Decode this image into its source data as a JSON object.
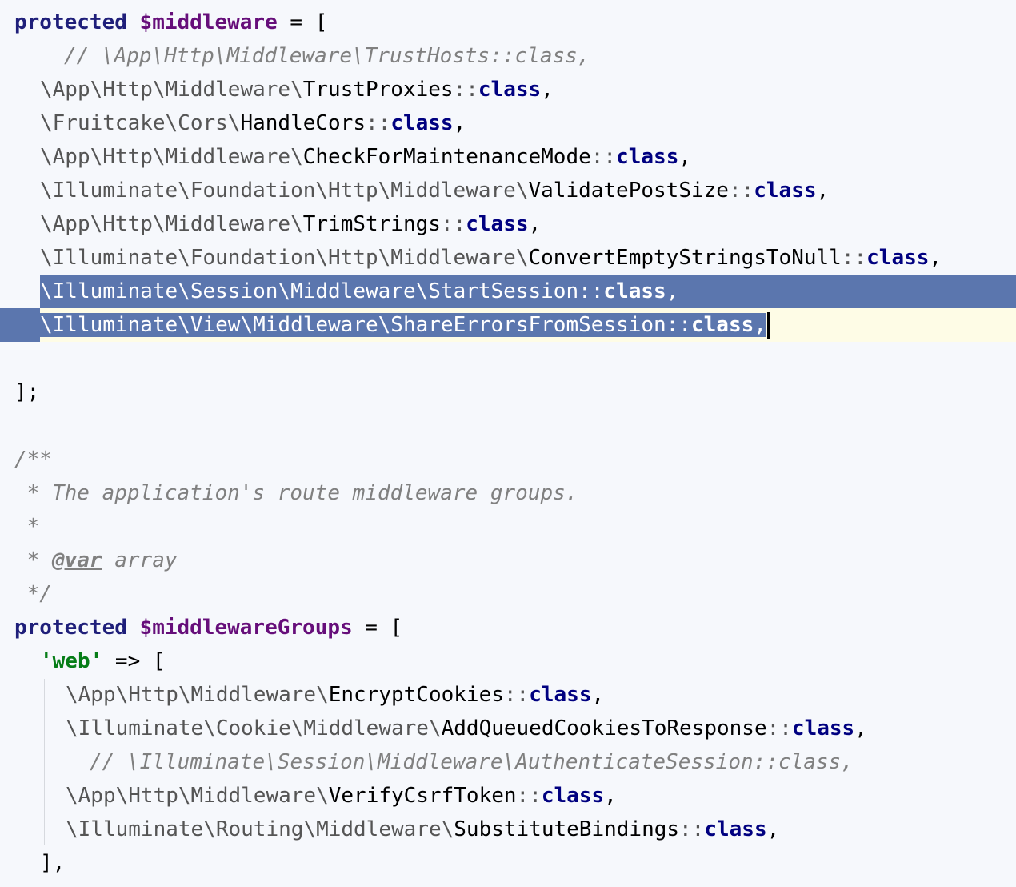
{
  "lines": [
    {
      "tokens": [
        {
          "t": "protected",
          "c": "kw2"
        },
        {
          "t": " ",
          "c": ""
        },
        {
          "t": "$middleware",
          "c": "var"
        },
        {
          "t": " = [",
          "c": ""
        }
      ]
    },
    {
      "tokens": [
        {
          "t": "// \\App\\Http\\Middleware\\TrustHosts::class,",
          "c": "cmt"
        }
      ]
    },
    {
      "tokens": [
        {
          "t": "\\App\\Http\\Middleware\\",
          "c": "ns"
        },
        {
          "t": "TrustProxies",
          "c": ""
        },
        {
          "t": "::",
          "c": "ns"
        },
        {
          "t": "class",
          "c": "cls"
        },
        {
          "t": ",",
          "c": ""
        }
      ]
    },
    {
      "tokens": [
        {
          "t": "\\Fruitcake\\Cors\\",
          "c": "ns"
        },
        {
          "t": "HandleCors",
          "c": ""
        },
        {
          "t": "::",
          "c": "ns"
        },
        {
          "t": "class",
          "c": "cls"
        },
        {
          "t": ",",
          "c": ""
        }
      ]
    },
    {
      "tokens": [
        {
          "t": "\\App\\Http\\Middleware\\",
          "c": "ns"
        },
        {
          "t": "CheckForMaintenanceMode",
          "c": ""
        },
        {
          "t": "::",
          "c": "ns"
        },
        {
          "t": "class",
          "c": "cls"
        },
        {
          "t": ",",
          "c": ""
        }
      ]
    },
    {
      "tokens": [
        {
          "t": "\\Illuminate\\Foundation\\Http\\Middleware\\",
          "c": "ns"
        },
        {
          "t": "ValidatePostSize",
          "c": ""
        },
        {
          "t": "::",
          "c": "ns"
        },
        {
          "t": "class",
          "c": "cls"
        },
        {
          "t": ",",
          "c": ""
        }
      ]
    },
    {
      "tokens": [
        {
          "t": "\\App\\Http\\Middleware\\",
          "c": "ns"
        },
        {
          "t": "TrimStrings",
          "c": ""
        },
        {
          "t": "::",
          "c": "ns"
        },
        {
          "t": "class",
          "c": "cls"
        },
        {
          "t": ",",
          "c": ""
        }
      ]
    },
    {
      "tokens": [
        {
          "t": "\\Illuminate\\Foundation\\Http\\Middleware\\",
          "c": "ns"
        },
        {
          "t": "ConvertEmptyStringsToNull",
          "c": ""
        },
        {
          "t": "::",
          "c": "ns"
        },
        {
          "t": "class",
          "c": "cls"
        },
        {
          "t": ",",
          "c": ""
        }
      ]
    },
    {
      "tokens": [
        {
          "t": "\\Illuminate\\Session\\Middleware\\",
          "c": "ns"
        },
        {
          "t": "StartSession",
          "c": ""
        },
        {
          "t": "::",
          "c": "ns"
        },
        {
          "t": "class",
          "c": "cls"
        },
        {
          "t": ",",
          "c": ""
        }
      ]
    },
    {
      "tokens": [
        {
          "t": "\\Illuminate\\View\\Middleware\\",
          "c": "ns"
        },
        {
          "t": "ShareErrorsFromSession",
          "c": ""
        },
        {
          "t": "::",
          "c": "ns"
        },
        {
          "t": "class",
          "c": "cls"
        },
        {
          "t": ",",
          "c": ""
        }
      ]
    },
    {
      "tokens": []
    },
    {
      "tokens": [
        {
          "t": "];",
          "c": ""
        }
      ]
    },
    {
      "tokens": []
    },
    {
      "tokens": [
        {
          "t": "/**",
          "c": "cmt"
        }
      ]
    },
    {
      "tokens": [
        {
          "t": " * The application's route middleware groups.",
          "c": "cmt"
        }
      ]
    },
    {
      "tokens": [
        {
          "t": " *",
          "c": "cmt"
        }
      ]
    },
    {
      "tokens": [
        {
          "t": " * ",
          "c": "cmt"
        },
        {
          "t": "@var",
          "c": "doctag"
        },
        {
          "t": " array",
          "c": "cmt"
        }
      ]
    },
    {
      "tokens": [
        {
          "t": " */",
          "c": "cmt"
        }
      ]
    },
    {
      "tokens": [
        {
          "t": "protected",
          "c": "kw2"
        },
        {
          "t": " ",
          "c": ""
        },
        {
          "t": "$middlewareGroups",
          "c": "var"
        },
        {
          "t": " = [",
          "c": ""
        }
      ]
    },
    {
      "tokens": [
        {
          "t": "'web'",
          "c": "str"
        },
        {
          "t": " => [",
          "c": ""
        }
      ]
    },
    {
      "tokens": [
        {
          "t": "\\App\\Http\\Middleware\\",
          "c": "ns"
        },
        {
          "t": "EncryptCookies",
          "c": ""
        },
        {
          "t": "::",
          "c": "ns"
        },
        {
          "t": "class",
          "c": "cls"
        },
        {
          "t": ",",
          "c": ""
        }
      ]
    },
    {
      "tokens": [
        {
          "t": "\\Illuminate\\Cookie\\Middleware\\",
          "c": "ns"
        },
        {
          "t": "AddQueuedCookiesToResponse",
          "c": ""
        },
        {
          "t": "::",
          "c": "ns"
        },
        {
          "t": "class",
          "c": "cls"
        },
        {
          "t": ",",
          "c": ""
        }
      ]
    },
    {
      "tokens": [
        {
          "t": "// \\Illuminate\\Session\\Middleware\\AuthenticateSession::class,",
          "c": "cmt"
        }
      ]
    },
    {
      "tokens": [
        {
          "t": "\\App\\Http\\Middleware\\",
          "c": "ns"
        },
        {
          "t": "VerifyCsrfToken",
          "c": ""
        },
        {
          "t": "::",
          "c": "ns"
        },
        {
          "t": "class",
          "c": "cls"
        },
        {
          "t": ",",
          "c": ""
        }
      ]
    },
    {
      "tokens": [
        {
          "t": "\\Illuminate\\Routing\\Middleware\\",
          "c": "ns"
        },
        {
          "t": "SubstituteBindings",
          "c": ""
        },
        {
          "t": "::",
          "c": "ns"
        },
        {
          "t": "class",
          "c": "cls"
        },
        {
          "t": ",",
          "c": ""
        }
      ]
    },
    {
      "tokens": [
        {
          "t": "],",
          "c": ""
        }
      ]
    }
  ]
}
